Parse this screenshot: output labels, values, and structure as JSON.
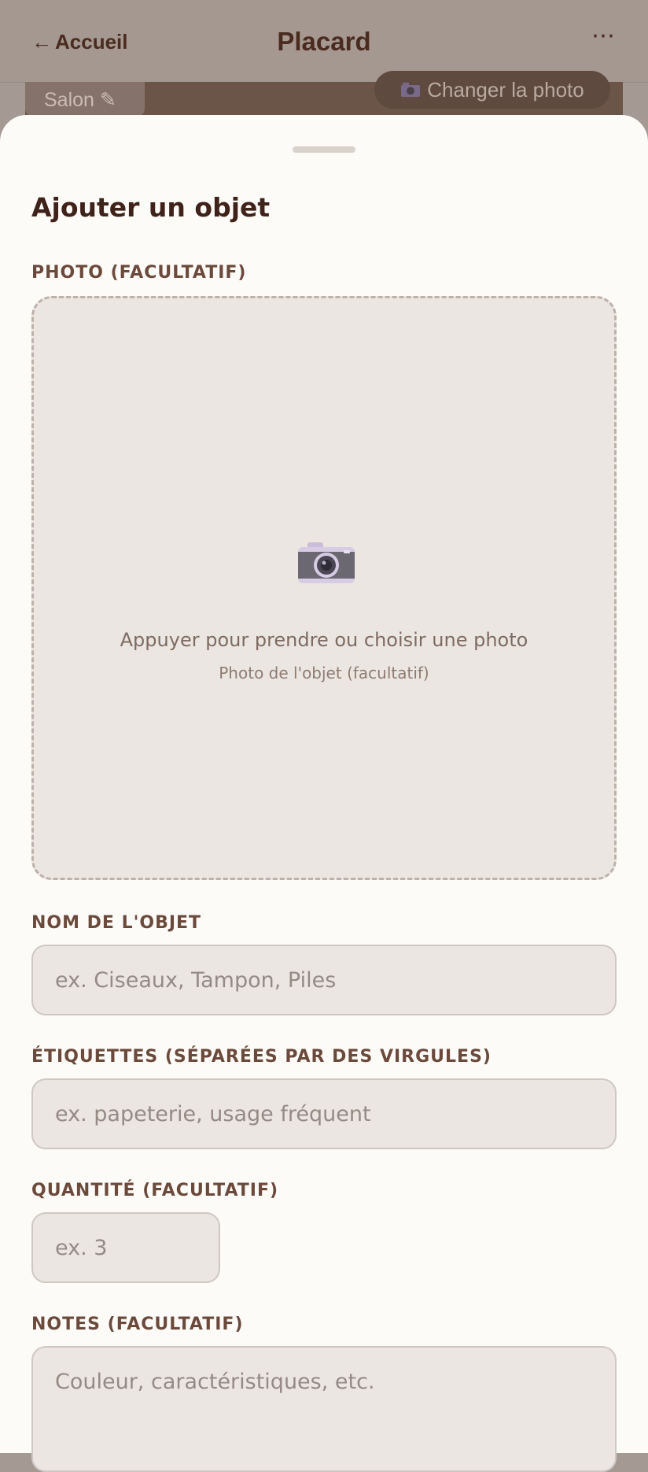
{
  "header": {
    "back_label": "Accueil",
    "back_arrow": "←",
    "title": "Placard",
    "more_label": "⋯"
  },
  "room_banner": {
    "room_label": "Salon ✎",
    "change_photo_label": "Changer la photo"
  },
  "sheet": {
    "title": "Ajouter un objet",
    "photo": {
      "label": "PHOTO (FACULTATIF)",
      "prompt": "Appuyer pour prendre ou choisir une photo",
      "hint": "Photo de l'objet (facultatif)"
    },
    "name": {
      "label": "NOM DE L'OBJET",
      "placeholder": "ex. Ciseaux, Tampon, Piles",
      "value": ""
    },
    "tags": {
      "label": "ÉTIQUETTES (SÉPARÉES PAR DES VIRGULES)",
      "placeholder": "ex. papeterie, usage fréquent",
      "value": ""
    },
    "quantity": {
      "label": "QUANTITÉ (FACULTATIF)",
      "placeholder": "ex. 3",
      "value": ""
    },
    "notes": {
      "label": "NOTES (FACULTATIF)",
      "placeholder": "Couleur, caractéristiques, etc.",
      "value": ""
    }
  },
  "icons": {
    "camera": "camera-icon",
    "back": "back-arrow-icon",
    "more": "more-icon",
    "edit": "pencil-icon"
  },
  "colors": {
    "accent_text": "#4a2b20",
    "sheet_bg": "#fdfbf7",
    "field_bg": "#ebe6e2",
    "label": "#6b4a3c"
  }
}
